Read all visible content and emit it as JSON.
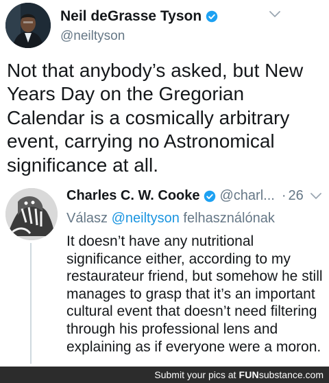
{
  "tweet": {
    "author_name": "Neil deGrasse Tyson",
    "author_handle": "@neiltyson",
    "text": "Not that anybody’s asked, but New\nYears Day on the Gregorian\nCalendar is a cosmically arbitrary\nevent, carrying no Astronomical\nsignificance at all."
  },
  "reply": {
    "author_name": "Charles C. W. Cooke",
    "author_handle": "@charl...",
    "separator": "·",
    "time": "26",
    "replying_prefix": "Válasz ",
    "replying_mention": "@neiltyson",
    "replying_suffix": " felhasználónak",
    "text": "It doesn’t have any nutritional\nsignificance either, according to my\nrestaurateur friend, but somehow he still\nmanages to grasp that it’s an important\ncultural event that doesn’t need filtering\nthrough his professional lens and\nexplaining as if everyone were a moron."
  },
  "footer": {
    "text": "Submit your pics at",
    "brand_part1": "FUN",
    "brand_part2": "substance",
    "brand_part3": ".com"
  },
  "colors": {
    "verified_blue": "#1da1f2",
    "secondary_text": "#657786",
    "link_blue": "#1b95e0",
    "footer_bg": "#2c2c2c"
  },
  "icons": {
    "verified": "verified-badge-icon",
    "chevron": "chevron-down-icon"
  }
}
